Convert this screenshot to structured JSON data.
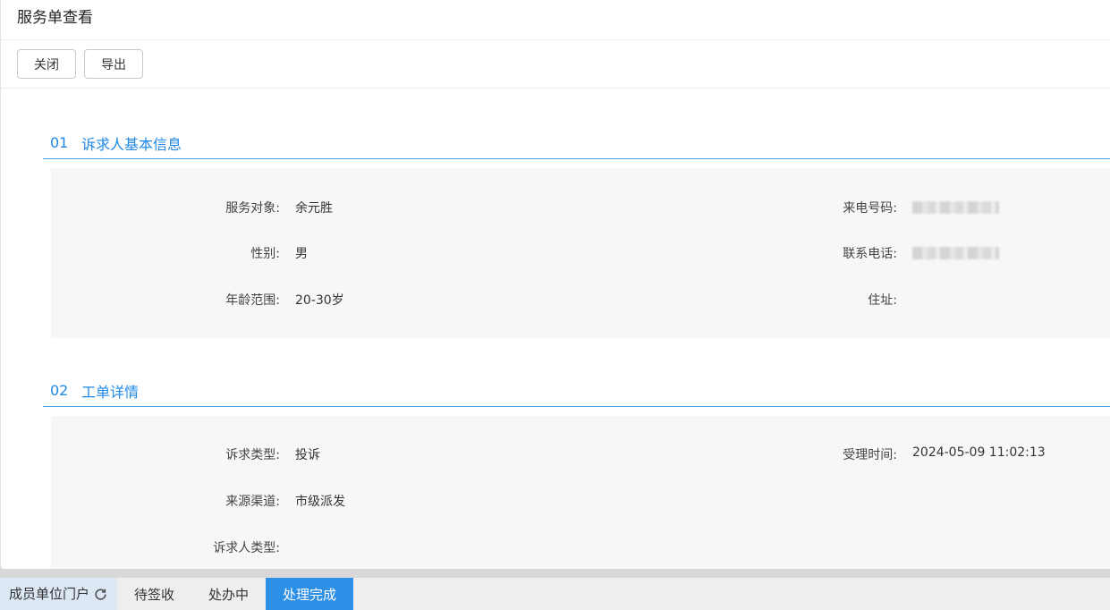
{
  "panel": {
    "title": "服务单查看",
    "buttons": {
      "close": "关闭",
      "export": "导出"
    }
  },
  "section1": {
    "num": "01",
    "title": "诉求人基本信息",
    "fields": {
      "service_target_label": "服务对象:",
      "service_target_value": "余元胜",
      "incoming_number_label": "来电号码:",
      "gender_label": "性别:",
      "gender_value": "男",
      "contact_phone_label": "联系电话:",
      "age_range_label": "年龄范围:",
      "age_range_value": "20-30岁",
      "address_label": "住址:"
    }
  },
  "section2": {
    "num": "02",
    "title": "工单详情",
    "fields": {
      "complaint_type_label": "诉求类型:",
      "complaint_type_value": "投诉",
      "accept_time_label": "受理时间:",
      "accept_time_value": "2024-05-09 11:02:13",
      "source_channel_label": "来源渠道:",
      "source_channel_value": "市级派发",
      "appellant_type_label": "诉求人类型:"
    }
  },
  "tabbar": {
    "portal": "成员单位门户",
    "tabs": [
      "待签收",
      "处办中",
      "处理完成"
    ],
    "active_tab": "处理完成"
  },
  "colors": {
    "accent": "#1e88e5",
    "active_tab": "#2d8fe6"
  }
}
